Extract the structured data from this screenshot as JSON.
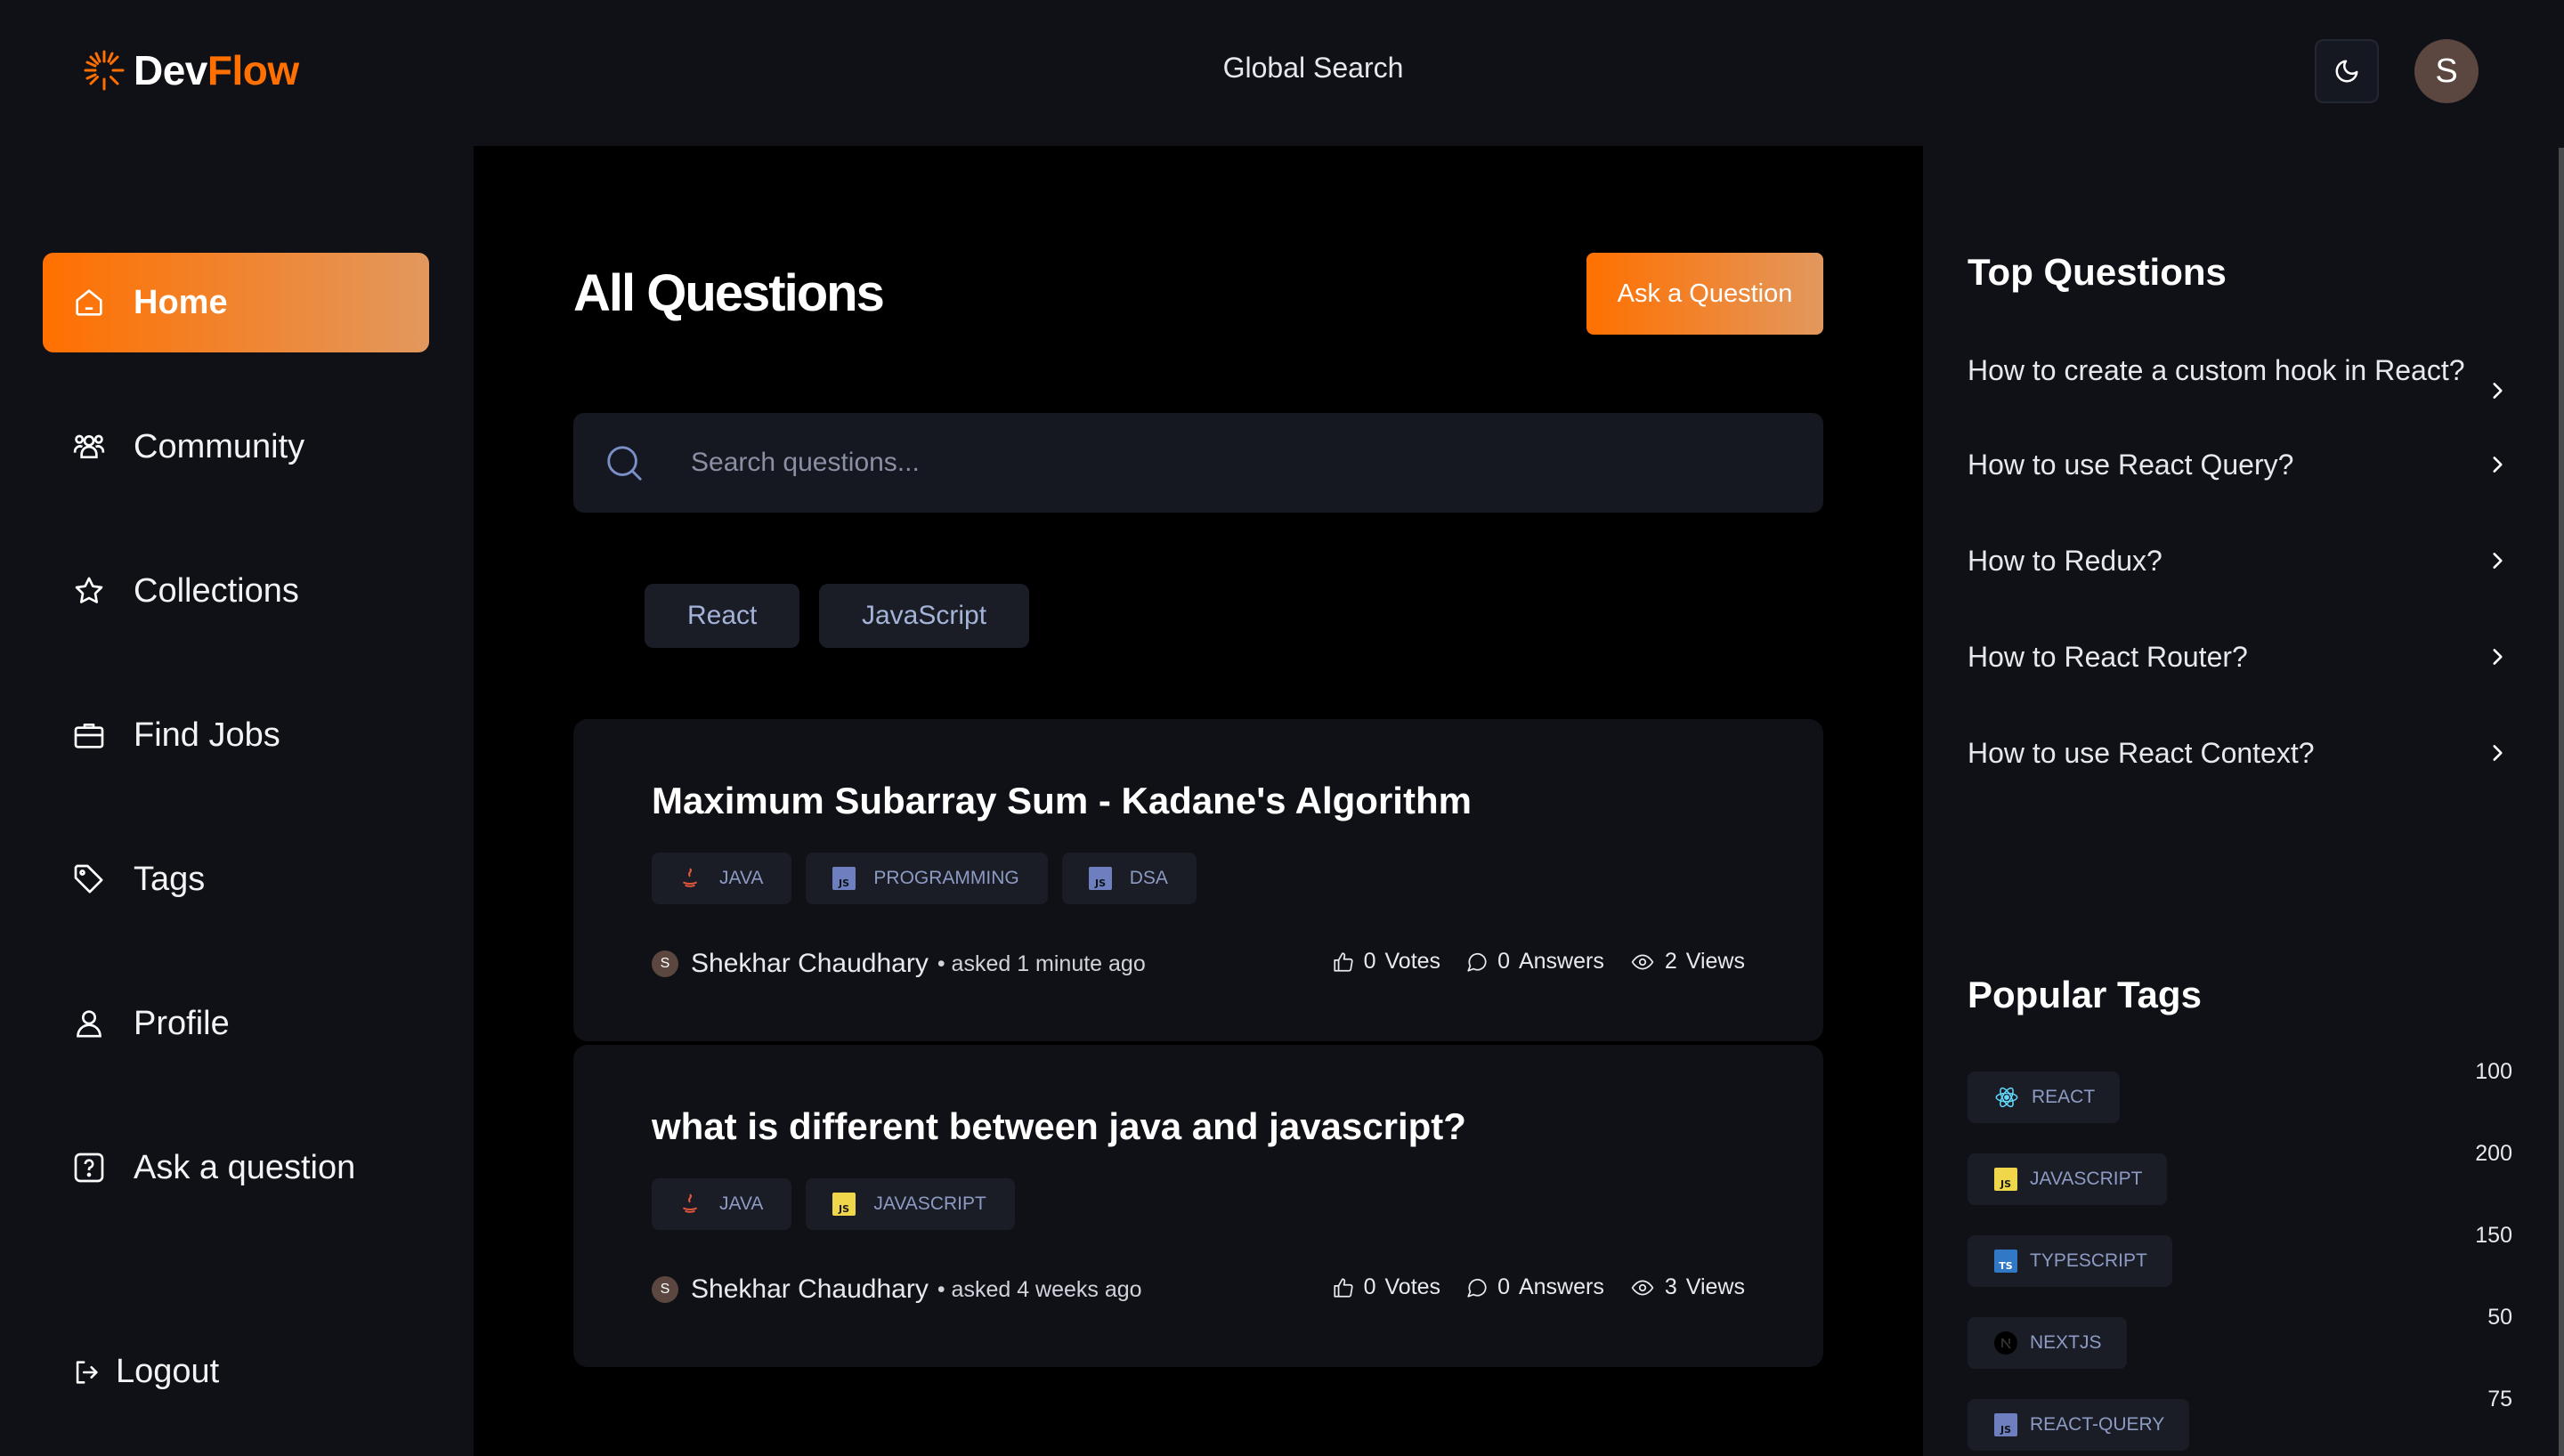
{
  "brand": {
    "part1": "Dev",
    "part2": "Flow",
    "accent": "#ff7000"
  },
  "header": {
    "global_search": "Global Search",
    "theme_icon": "moon-icon",
    "avatar_initial": "S"
  },
  "sidebar": {
    "items": [
      {
        "label": "Home",
        "icon": "home-icon",
        "active": true
      },
      {
        "label": "Community",
        "icon": "users-icon"
      },
      {
        "label": "Collections",
        "icon": "star-icon"
      },
      {
        "label": "Find Jobs",
        "icon": "briefcase-icon"
      },
      {
        "label": "Tags",
        "icon": "tag-icon"
      },
      {
        "label": "Profile",
        "icon": "user-icon"
      },
      {
        "label": "Ask a question",
        "icon": "question-icon"
      }
    ],
    "logout_label": "Logout"
  },
  "main": {
    "title": "All Questions",
    "ask_button": "Ask a Question",
    "search_placeholder": "Search questions...",
    "filters": [
      "React",
      "JavaScript"
    ],
    "questions": [
      {
        "title": "Maximum Subarray Sum - Kadane's Algorithm",
        "tags": [
          {
            "name": "JAVA",
            "icon": "java-icon"
          },
          {
            "name": "PROGRAMMING",
            "icon": "js-icon"
          },
          {
            "name": "DSA",
            "icon": "js-icon"
          }
        ],
        "author_initial": "S",
        "author": "Shekhar Chaudhary",
        "asked": "• asked 1 minute ago",
        "votes": "0",
        "votes_label": "Votes",
        "answers": "0",
        "answers_label": "Answers",
        "views": "2",
        "views_label": "Views"
      },
      {
        "title": "what is different between java and javascript?",
        "tags": [
          {
            "name": "JAVA",
            "icon": "java-icon"
          },
          {
            "name": "JAVASCRIPT",
            "icon": "javascript-icon"
          }
        ],
        "author_initial": "S",
        "author": "Shekhar Chaudhary",
        "asked": "• asked 4 weeks ago",
        "votes": "0",
        "votes_label": "Votes",
        "answers": "0",
        "answers_label": "Answers",
        "views": "3",
        "views_label": "Views"
      }
    ]
  },
  "right": {
    "top_questions_title": "Top Questions",
    "top_questions": [
      "How to create a custom hook in React?",
      "How to use React Query?",
      "How to Redux?",
      "How to React Router?",
      "How to use React Context?"
    ],
    "popular_tags_title": "Popular Tags",
    "popular_tags": [
      {
        "name": "REACT",
        "count": "100",
        "icon": "react-icon"
      },
      {
        "name": "JAVASCRIPT",
        "count": "200",
        "icon": "javascript-icon"
      },
      {
        "name": "TYPESCRIPT",
        "count": "150",
        "icon": "typescript-icon"
      },
      {
        "name": "NEXTJS",
        "count": "50",
        "icon": "nextjs-icon"
      },
      {
        "name": "REACT-QUERY",
        "count": "75",
        "icon": "js-icon"
      }
    ]
  }
}
